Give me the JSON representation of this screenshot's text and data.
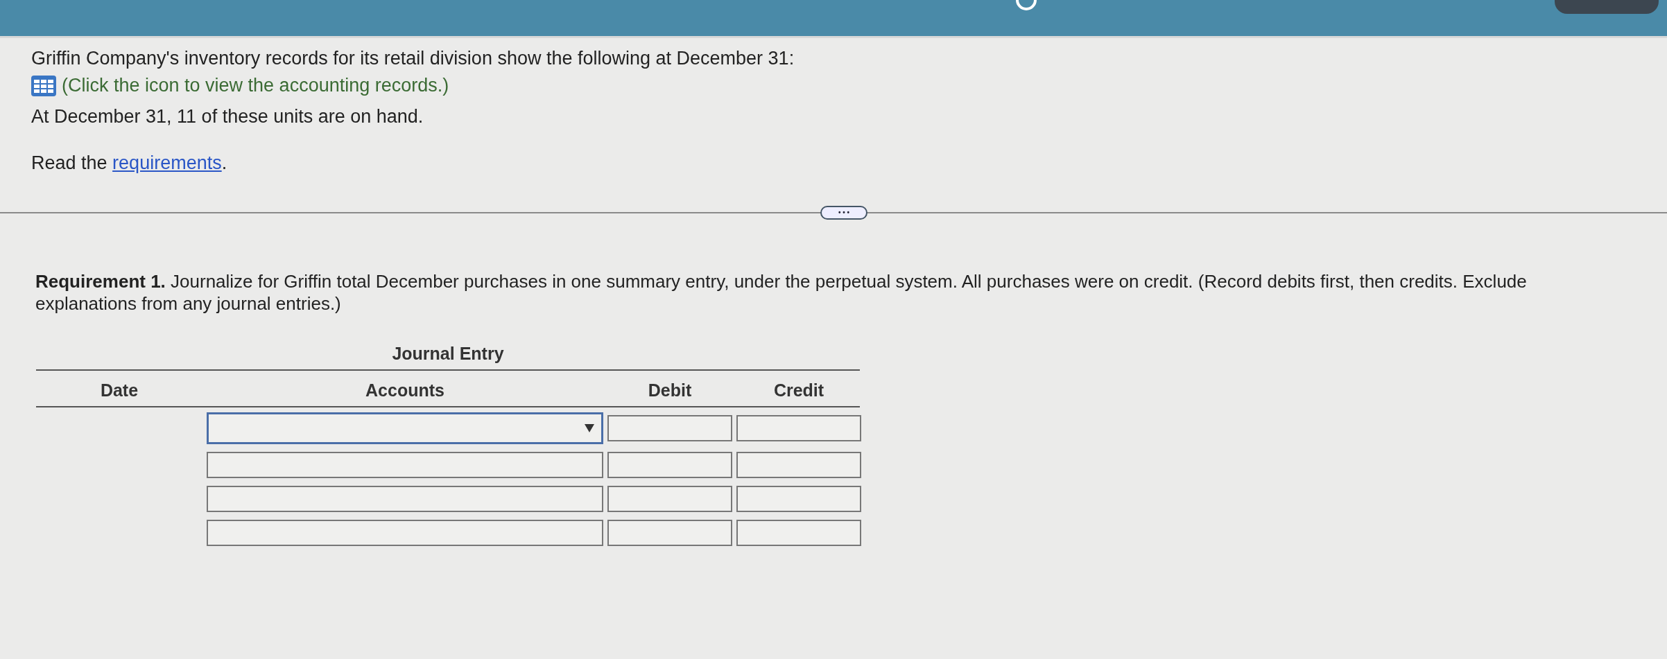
{
  "intro": {
    "text": "Griffin Company's inventory records for its retail division show the following at December 31:",
    "records_hint": "(Click the icon to view the accounting records.)",
    "on_hand": "At December 31, 11 of these units are on hand.",
    "read_prefix": "Read the",
    "read_link": "requirements",
    "read_suffix": "."
  },
  "expand_button": "• • •",
  "requirement": "**Requirement 1.** Journalize for Griffin total December purchases in one summary entry, under the perpetual system. All purchases were on credit. (Record debits first, then credits. Exclude explanations from any journal entries.)",
  "journal": {
    "title": "Journal Entry",
    "columns": [
      "Date",
      "Accounts",
      "Debit",
      "Credit"
    ],
    "rows": [
      {
        "kind": "dropdown",
        "focused": true
      },
      {
        "kind": "text",
        "focused": false
      },
      {
        "kind": "text",
        "focused": false
      },
      {
        "kind": "text",
        "focused": false
      }
    ]
  }
}
